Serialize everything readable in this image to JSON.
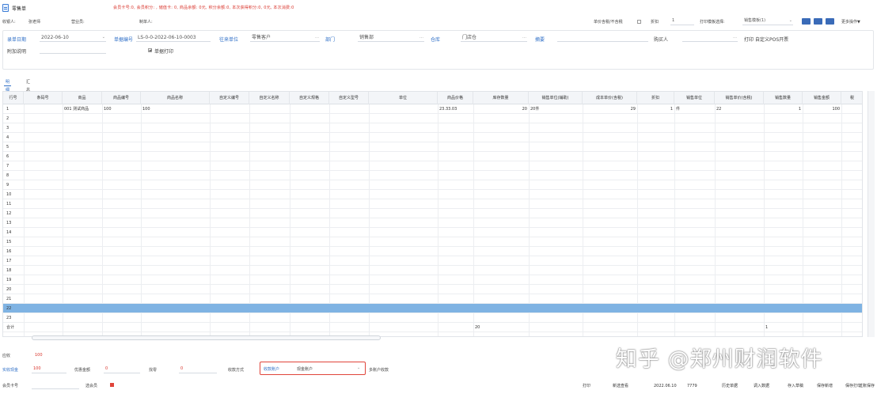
{
  "app": {
    "title": "零售单",
    "notice": "会员卡号:0,  会员积分:  ,  储值卡:  0,  商品余额:  0元,  积分余额:0,  本次获得积分:0,  0元,  本次消费:0"
  },
  "header": {
    "cashier_label": "收银人:",
    "cashier_value": "张老师",
    "clerk_label": "营业员:",
    "operator_label": "制单人:",
    "price_mode_label": "单价含税/不含税",
    "discount_label": "折扣",
    "discount_value": "1",
    "template_label": "打印模板选择:",
    "template_value": "销售模板(1)",
    "more_label": "更多操作▼",
    "btn_colors": [
      "#3a6bb8",
      "#3a6bb8",
      "#3a6bb8"
    ]
  },
  "form": {
    "date_label": "录单日期",
    "date_value": "2022-06-10",
    "number_label": "单据编号",
    "number_value": "LS-0-0-2022-06-10-0003",
    "customer_label": "往来单位",
    "customer_value": "零售客户",
    "dept_label": "部门",
    "dept_value": "销售部",
    "warehouse_label": "仓库",
    "warehouse_value": "门店仓",
    "summary_label": "摘要",
    "note_label": "附加说明",
    "pos_label": "自定义POS开票",
    "print_label": "打印",
    "buyer_label": "购买人",
    "auto_print_label": "单据打印"
  },
  "tabs": [
    "明细",
    "汇总"
  ],
  "table": {
    "columns": [
      "行号",
      "条码号",
      "商品",
      "商品编号",
      "商品名称",
      "自定义编号",
      "自定义名称",
      "自定义规格",
      "自定义型号",
      "单位",
      "商品价格",
      "库存数量",
      "销售单位(辅助)",
      "成本单价(含税)",
      "折扣",
      "销售单位",
      "销售单价(含税)",
      "销售数量",
      "销售金额",
      "税"
    ],
    "row_numbers": [
      "1",
      "2",
      "3",
      "4",
      "5",
      "6",
      "7",
      "8",
      "9",
      "10",
      "11",
      "12",
      "13",
      "14",
      "15",
      "16",
      "17",
      "18",
      "19",
      "20",
      "21",
      "22",
      "23",
      "合计"
    ],
    "first_row": {
      "product": "001 测试商品",
      "code": "100",
      "name": "100",
      "price": "23.33.03",
      "stock": "20",
      "unit_aux": "20件",
      "cost": "29",
      "discount": "1",
      "sale_unit": "件",
      "sale_price": "22",
      "qty": "1",
      "amount": "100"
    },
    "total_row": {
      "stock": "20",
      "qty": "1"
    }
  },
  "footer": {
    "payable_label": "应收",
    "payable_value": "100",
    "received_label": "实收现金",
    "received_value": "100",
    "change_label": "优惠金额",
    "change_value": "0",
    "change2_label": "找零",
    "change2_value": "0",
    "coupon_label": "收款方式",
    "account_label": "收款账户",
    "account_value": "现金账户",
    "more_account_label": "多账户收款",
    "member_label": "会员卡号",
    "member_btn_label": "选会员"
  },
  "bottom_buttons": [
    "打印",
    "新选查看",
    "2022.06.10",
    "7779",
    "历史单据",
    "调入数据",
    "存入草稿",
    "保存新增",
    "保存打印",
    "过账保存"
  ],
  "watermark": "知乎 @郑州财润软件"
}
